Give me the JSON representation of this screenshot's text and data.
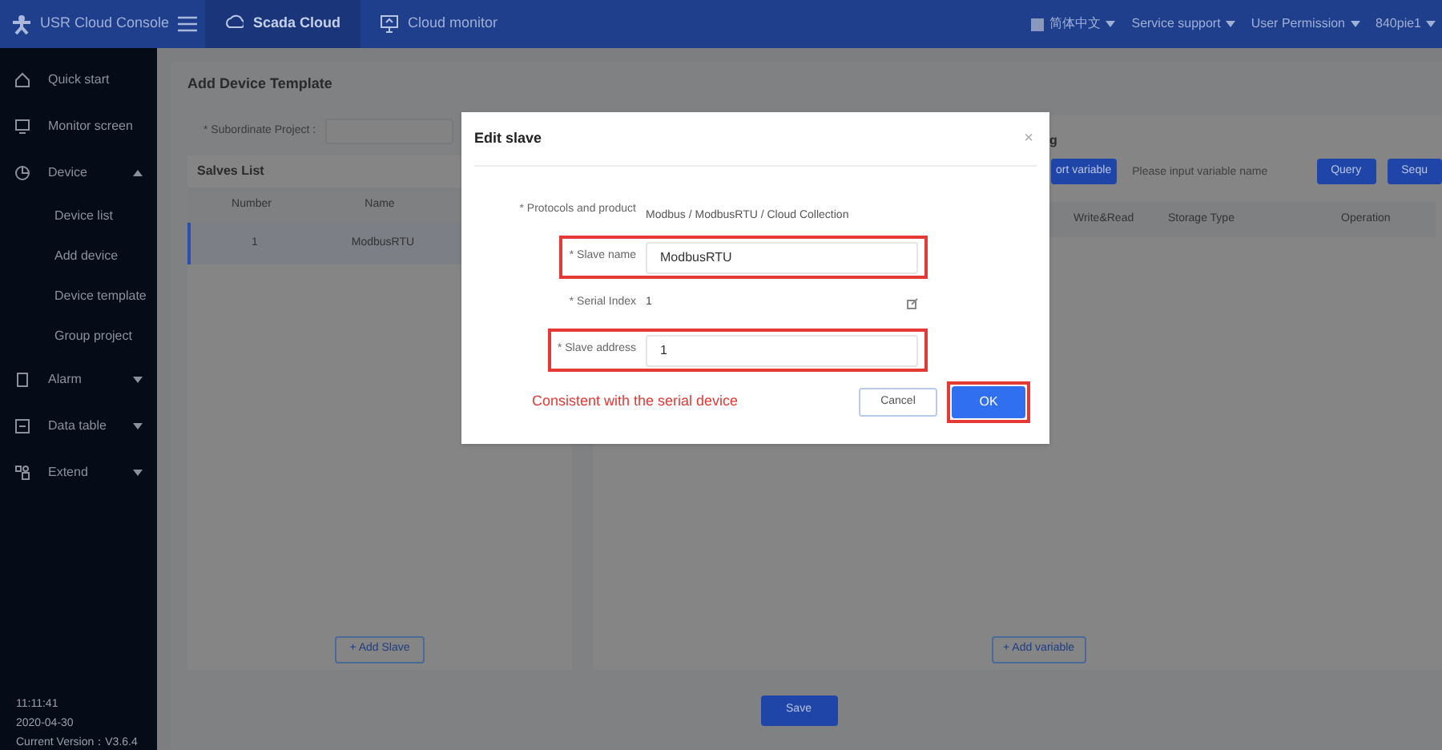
{
  "topbar": {
    "brand": "USR Cloud Console",
    "tabs": [
      {
        "label": "Scada Cloud",
        "selected": true
      },
      {
        "label": "Cloud monitor",
        "selected": false
      }
    ],
    "menus": [
      "简体中文",
      "Service support",
      "User Permission",
      "840pie1"
    ]
  },
  "sidebar": {
    "items": [
      {
        "label": "Quick start"
      },
      {
        "label": "Monitor screen"
      },
      {
        "label": "Device",
        "expanded": true,
        "children": [
          {
            "label": "Device list"
          },
          {
            "label": "Add device"
          },
          {
            "label": "Device template"
          },
          {
            "label": "Group project"
          }
        ]
      },
      {
        "label": "Alarm",
        "expanded": false
      },
      {
        "label": "Data table",
        "expanded": false
      },
      {
        "label": "Extend",
        "expanded": false
      }
    ],
    "footer": [
      "11:11:41",
      "2020-04-30",
      "Current Version：V3.6.4"
    ]
  },
  "page": {
    "title": "Add Device Template",
    "project_label": "* Subordinate Project :",
    "slaves": {
      "title": "Salves List",
      "columns": [
        "Number",
        "Name"
      ],
      "rows": [
        {
          "cells": [
            "1",
            "ModbusRTU"
          ],
          "selected": true
        }
      ],
      "add_button": "+ Add Slave"
    },
    "variables": {
      "title": "g",
      "import_button": "ort variable",
      "search": {
        "placeholder": "Please input variable name"
      },
      "buttons": [
        "Query",
        "Sequ"
      ],
      "columns": [
        "Write&Read",
        "Storage Type",
        "Operation"
      ],
      "add_button": "+ Add variable"
    },
    "save_button": "Save"
  },
  "dialog": {
    "title": "Edit slave",
    "close": "×",
    "fields": [
      {
        "kind": "text",
        "label": "* Protocols and product",
        "value": "Modbus / ModbusRTU / Cloud Collection",
        "highlighted": false
      },
      {
        "kind": "input",
        "label": "* Slave name",
        "value": "ModbusRTU",
        "highlighted": true
      },
      {
        "kind": "editable",
        "label": "* Serial Index",
        "value": "1",
        "highlighted": false
      },
      {
        "kind": "input",
        "label": "* Slave address",
        "value": "1",
        "highlighted": true
      }
    ],
    "note": "Consistent with the serial device",
    "cancel": "Cancel",
    "ok": "OK",
    "ok_highlighted": true
  }
}
